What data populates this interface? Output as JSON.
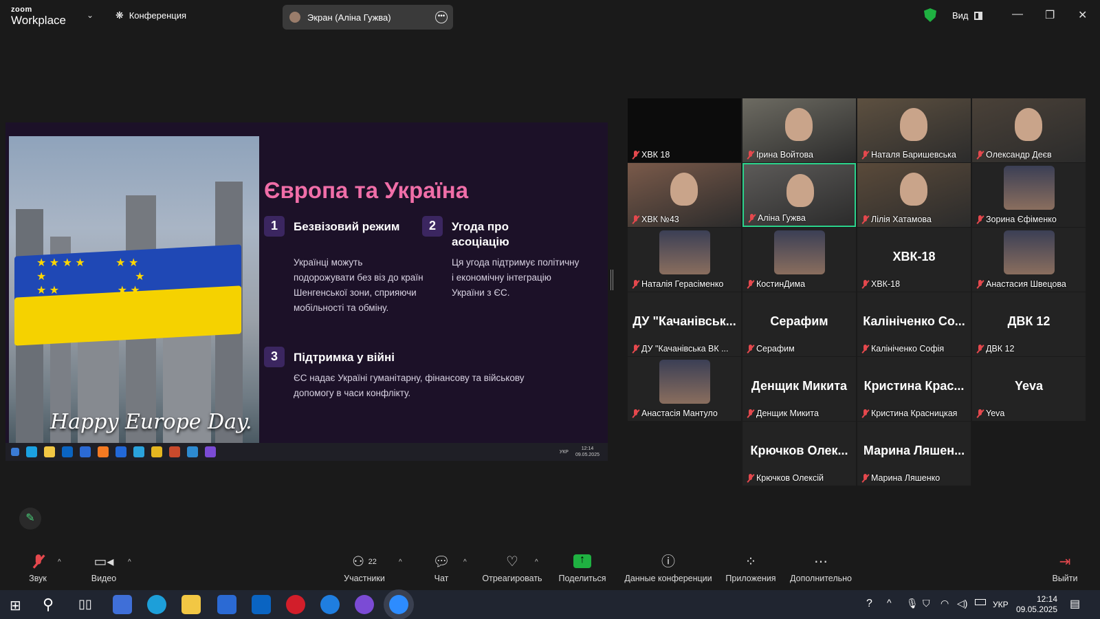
{
  "topbar": {
    "logo_small": "zoom",
    "logo_big": "Workplace",
    "conference": "Конференция",
    "screen_label": "Экран (Аліна Гужва)",
    "view_label": "Вид"
  },
  "slide": {
    "title": "Європа та Україна",
    "items": [
      {
        "num": "1",
        "heading": "Безвізовий режим",
        "text": "Українці можуть подорожувати без віз до країн Шенгенської зони, сприяючи мобільності та обміну."
      },
      {
        "num": "2",
        "heading": "Угода про асоціацію",
        "text": "Ця угода підтримує політичну і економічну інтеграцію України з ЄС."
      },
      {
        "num": "3",
        "heading": "Підтримка у війні",
        "text": "ЄС надає Україні гуманітарну, фінансову та військову допомогу в часи конфлікту."
      }
    ],
    "image_caption": "Happy Europe Day.",
    "mini_taskbar": {
      "lang": "УКР",
      "time": "12:14",
      "date": "09.05.2025"
    }
  },
  "participants": [
    {
      "name": "ХВК 18",
      "big": "",
      "video": "dark",
      "active": false
    },
    {
      "name": "Ірина Войтова",
      "big": "",
      "video": "cam",
      "active": false
    },
    {
      "name": "Наталя Баришевська",
      "big": "",
      "video": "cam",
      "active": false
    },
    {
      "name": "Олександр Деєв",
      "big": "",
      "video": "cam",
      "active": false
    },
    {
      "name": "ХВК №43",
      "big": "",
      "video": "cam",
      "active": false
    },
    {
      "name": "Аліна Гужва",
      "big": "",
      "video": "cam",
      "active": true
    },
    {
      "name": "Лілія Хатамова",
      "big": "",
      "video": "cam",
      "active": false
    },
    {
      "name": "Зорина Єфіменко",
      "big": "",
      "video": "avatar",
      "active": false
    },
    {
      "name": "Наталія Герасіменко",
      "big": "",
      "video": "avatar",
      "active": false
    },
    {
      "name": "КостинДима",
      "big": "",
      "video": "avatar",
      "active": false
    },
    {
      "name": "ХВК-18",
      "big": "ХВК-18",
      "video": "none",
      "active": false
    },
    {
      "name": "Анастасия Швецова",
      "big": "",
      "video": "avatar",
      "active": false
    },
    {
      "name": "ДУ \"Качанівська ВК ...",
      "big": "ДУ \"Качанівськ...",
      "video": "none",
      "active": false
    },
    {
      "name": "Серафим",
      "big": "Серафим",
      "video": "none",
      "active": false
    },
    {
      "name": "Калініченко Софія",
      "big": "Калініченко Со...",
      "video": "none",
      "active": false
    },
    {
      "name": "ДВК 12",
      "big": "ДВК 12",
      "video": "none",
      "active": false
    },
    {
      "name": "Анастасія Мантуло",
      "big": "",
      "video": "avatar",
      "active": false
    },
    {
      "name": "Денщик Микита",
      "big": "Денщик Микита",
      "video": "none",
      "active": false
    },
    {
      "name": "Кристина Красницкая",
      "big": "Кристина Крас...",
      "video": "none",
      "active": false
    },
    {
      "name": "Yeva",
      "big": "Yeva",
      "video": "none",
      "active": false
    },
    {
      "name": "Крючков Олексій",
      "big": "Крючков Олек...",
      "video": "none",
      "active": false
    },
    {
      "name": "Марина Ляшенко",
      "big": "Марина Ляшен...",
      "video": "none",
      "active": false
    }
  ],
  "toolbar": {
    "audio": "Звук",
    "video": "Видео",
    "participants": "Участники",
    "participants_count": "22",
    "chat": "Чат",
    "react": "Отреагировать",
    "share": "Поделиться",
    "info": "Данные конференции",
    "apps": "Приложения",
    "more": "Дополнительно",
    "leave": "Выйти"
  },
  "taskbar": {
    "lang": "УКР",
    "time": "12:14",
    "date": "09.05.2025"
  }
}
